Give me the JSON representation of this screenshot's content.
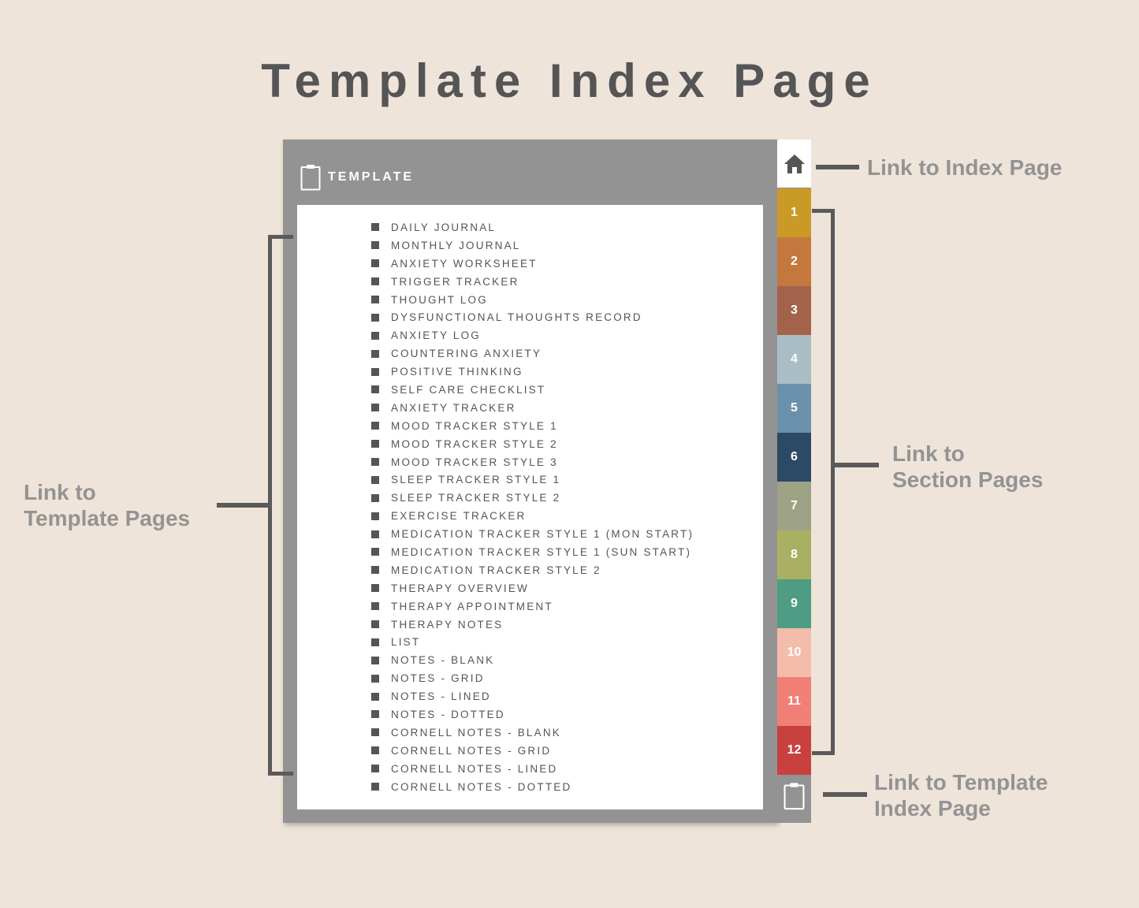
{
  "title": "Template Index Page",
  "header": {
    "label": "TEMPLATE"
  },
  "templates": [
    "DAILY JOURNAL",
    "MONTHLY JOURNAL",
    "ANXIETY WORKSHEET",
    "TRIGGER TRACKER",
    "THOUGHT LOG",
    "DYSFUNCTIONAL THOUGHTS RECORD",
    "ANXIETY LOG",
    "COUNTERING ANXIETY",
    "POSITIVE THINKING",
    "SELF CARE CHECKLIST",
    "ANXIETY TRACKER",
    "MOOD TRACKER STYLE 1",
    "MOOD TRACKER STYLE 2",
    "MOOD TRACKER STYLE 3",
    "SLEEP TRACKER STYLE 1",
    "SLEEP TRACKER STYLE 2",
    "EXERCISE TRACKER",
    "MEDICATION TRACKER STYLE 1 (MON START)",
    "MEDICATION TRACKER STYLE 1 (SUN START)",
    "MEDICATION TRACKER STYLE 2",
    "THERAPY OVERVIEW",
    "THERAPY APPOINTMENT",
    "THERAPY NOTES",
    "LIST",
    "NOTES - BLANK",
    "NOTES - GRID",
    "NOTES - LINED",
    "NOTES - DOTTED",
    "CORNELL NOTES - BLANK",
    "CORNELL NOTES - GRID",
    "CORNELL NOTES - LINED",
    "CORNELL NOTES - DOTTED"
  ],
  "tabs": [
    {
      "label": "1",
      "color": "#C99A25"
    },
    {
      "label": "2",
      "color": "#C4783D"
    },
    {
      "label": "3",
      "color": "#A3634A"
    },
    {
      "label": "4",
      "color": "#A9BDC4"
    },
    {
      "label": "5",
      "color": "#6A91AB"
    },
    {
      "label": "6",
      "color": "#2C4A66"
    },
    {
      "label": "7",
      "color": "#9DA285"
    },
    {
      "label": "8",
      "color": "#A9B063"
    },
    {
      "label": "9",
      "color": "#4E9C84"
    },
    {
      "label": "10",
      "color": "#F4BCAA"
    },
    {
      "label": "11",
      "color": "#F07F76"
    },
    {
      "label": "12",
      "color": "#C8413F"
    }
  ],
  "annotations": {
    "index_page": "Link to Index Page",
    "section_pages_line1": "Link to",
    "section_pages_line2": "Section Pages",
    "template_pages_line1": "Link to",
    "template_pages_line2": "Template Pages",
    "template_index_line1": "Link to Template",
    "template_index_line2": "Index Page"
  },
  "icons": {
    "home": "home-icon",
    "clipboard": "clipboard-icon"
  }
}
